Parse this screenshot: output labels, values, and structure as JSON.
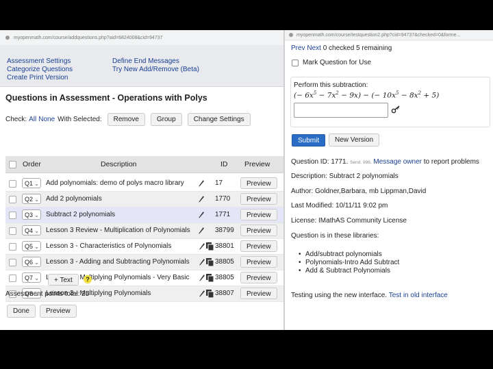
{
  "left": {
    "url": "myopenmath.com/course/addquestions.php?aid=6824008&cid=94737",
    "nav": {
      "assessment_settings": "Assessment Settings",
      "categorize_questions": "Categorize Questions",
      "create_print_version": "Create Print Version",
      "define_end_messages": "Define End Messages",
      "try_new_add_remove": "Try New Add/Remove (Beta)"
    },
    "title": "Questions in Assessment - Operations with Polys",
    "check_label": "Check:",
    "check_all": "All",
    "check_none": "None",
    "with_selected": "With Selected:",
    "remove_btn": "Remove",
    "group_btn": "Group",
    "change_settings_btn": "Change Settings",
    "columns": {
      "order": "Order",
      "description": "Description",
      "id": "ID",
      "preview": "Preview"
    },
    "rows": [
      {
        "order": "Q1",
        "description": "Add polynomials: demo of polys macro library",
        "id": "17",
        "preview": "Preview"
      },
      {
        "order": "Q2",
        "description": "Add 2 polynomials",
        "id": "1770",
        "preview": "Preview"
      },
      {
        "order": "Q3",
        "description": "Subtract 2 polynomials",
        "id": "1771",
        "preview": "Preview"
      },
      {
        "order": "Q4",
        "description": "Lesson 3 Review - Multiplication of Polynomials",
        "id": "38799",
        "preview": "Preview"
      },
      {
        "order": "Q5",
        "description": "Lesson 3 - Characteristics of Polynomials",
        "id": "38801",
        "preview": "Preview"
      },
      {
        "order": "Q6",
        "description": "Lesson 3 - Adding and Subtracting Polynomials",
        "id": "38805",
        "preview": "Preview"
      },
      {
        "order": "Q7",
        "description": "Lesson 3 - Multiplying Polynomials - Very Basic",
        "id": "38805",
        "preview": "Preview"
      },
      {
        "order": "Q8",
        "description": "Lesson 3 - Multiplying Polynomials",
        "id": "38807",
        "preview": "Preview"
      }
    ],
    "text_btn": "+ Text",
    "help": "?",
    "points_total": "Assessment points total: 25",
    "done_btn": "Done",
    "preview_btn": "Preview"
  },
  "right": {
    "url": "myopenmath.com/course/testquestion2.php?cid=94737&checked=0&forme...",
    "prev": "Prev",
    "next": "Next",
    "status": "0 checked 5 remaining",
    "mark_question": "Mark Question for Use",
    "prompt": "Perform this subtraction:",
    "submit_btn": "Submit",
    "new_version_btn": "New Version",
    "question_id_label": "Question ID: 1771.",
    "send_label": "Send. 996.",
    "message_owner": "Message owner",
    "report_text": "to report problems",
    "description": "Description: Subtract 2 polynomials",
    "author": "Author: Goldner,Barbara, mb Lippman,David",
    "last_modified": "Last Modified: 10/11/11 9:02 pm",
    "license": "License: IMathAS Community License",
    "libraries_label": "Question is in these libraries:",
    "libraries": [
      "Add/subtract polynomials",
      "Polynomials-Intro Add Subtract",
      "Add & Subtract Polynomials"
    ],
    "testing_text": "Testing using the new interface.",
    "old_interface": "Test in old interface"
  },
  "colors": {
    "link": "#1a3f94",
    "submit": "#2b6cc4",
    "highlight_row": "#e4e6f8",
    "help_badge": "#f0e040"
  },
  "icons": [
    "pencil-icon",
    "copy-icon",
    "key-icon",
    "chevron-down-icon",
    "help-icon"
  ]
}
